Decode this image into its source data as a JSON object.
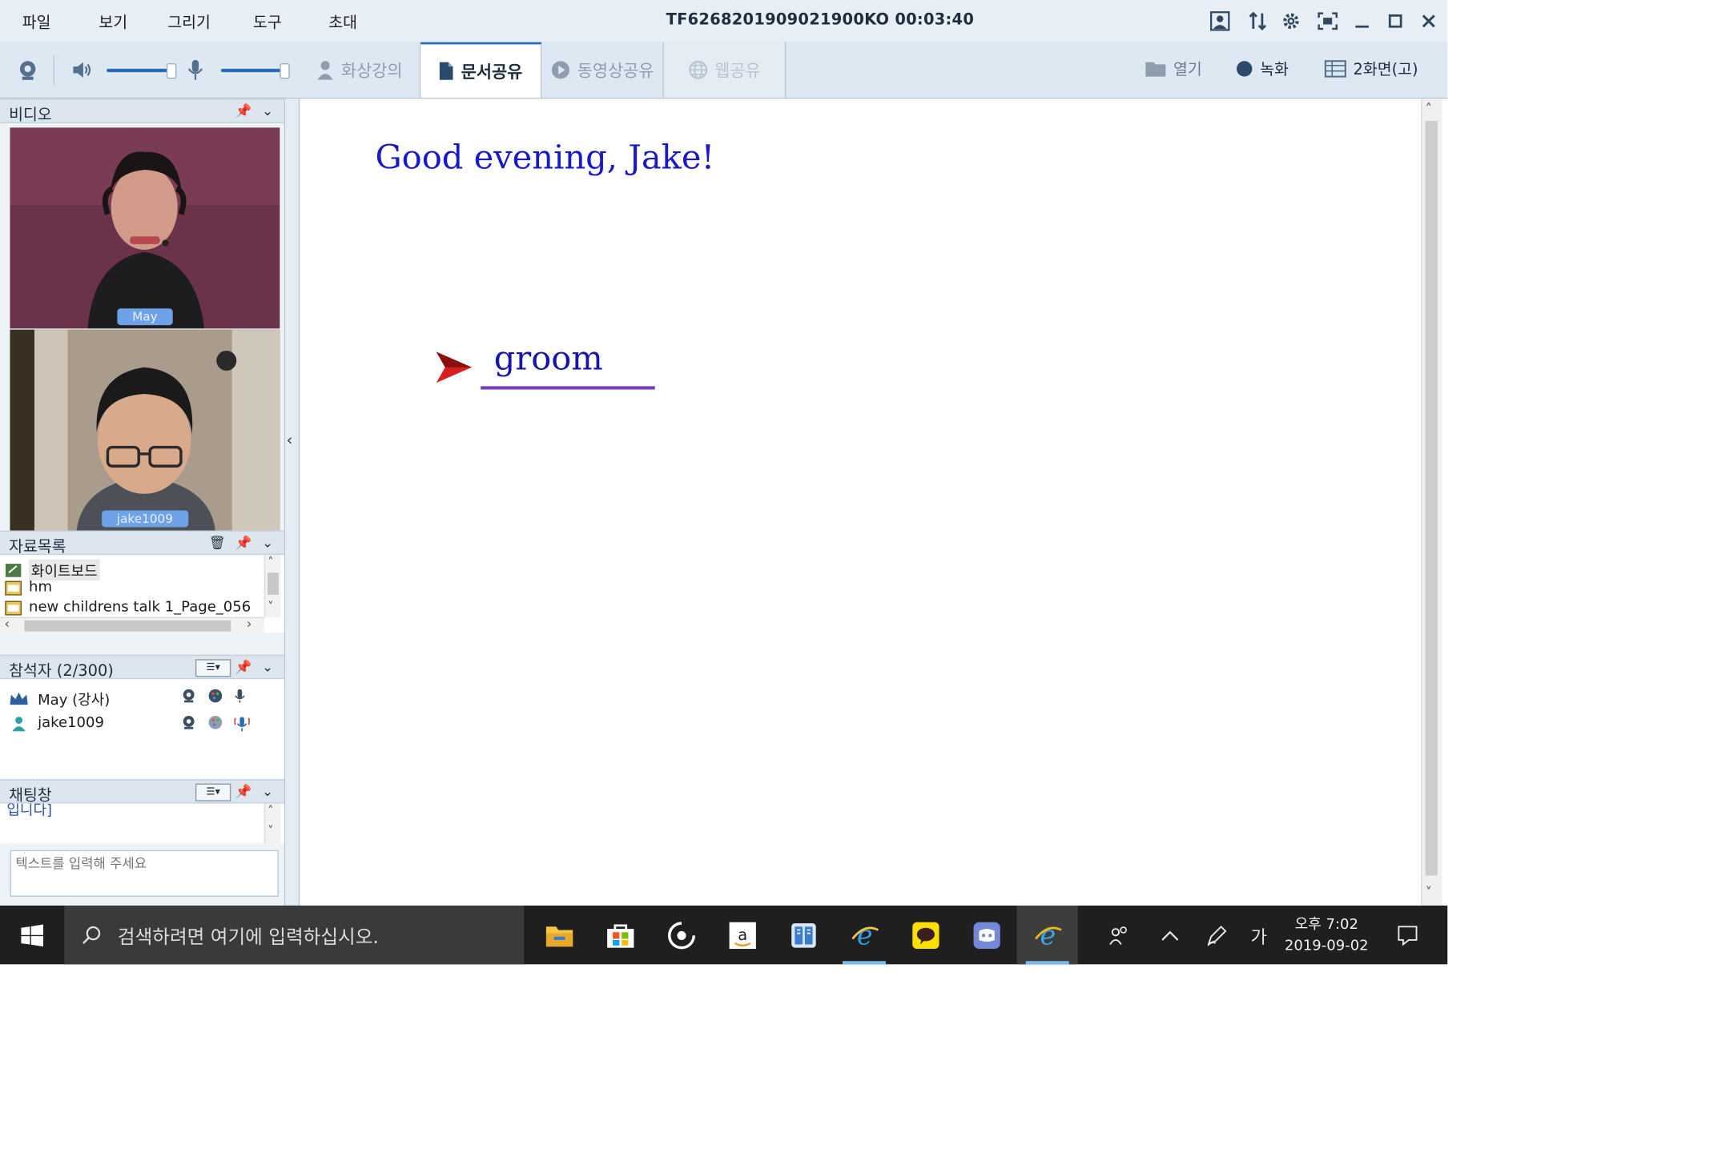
{
  "menu": {
    "items": [
      "파일",
      "보기",
      "그리기",
      "도구",
      "초대"
    ]
  },
  "window": {
    "title": "TF6268201909021900KO 00:03:40"
  },
  "toolbar": {
    "tabs": [
      {
        "label": "화상강의",
        "state": "normal"
      },
      {
        "label": "문서공유",
        "state": "active"
      },
      {
        "label": "동영상공유",
        "state": "normal"
      },
      {
        "label": "웹공유",
        "state": "disabled"
      }
    ],
    "open_label": "열기",
    "record_label": "녹화",
    "layout_label": "2화면(고)"
  },
  "sidebar": {
    "video": {
      "title": "비디오",
      "feeds": [
        {
          "name": "May"
        },
        {
          "name": "jake1009"
        }
      ]
    },
    "materials": {
      "title": "자료목록",
      "items": [
        "화이트보드",
        "hm",
        "new childrens talk 1_Page_056"
      ]
    },
    "participants": {
      "title": "참석자 (2/300)",
      "items": [
        {
          "name": "May (강사)"
        },
        {
          "name": "jake1009"
        }
      ]
    },
    "chat": {
      "title": "채팅창",
      "log_text": "입니다]",
      "input_placeholder": "텍스트를 입력해 주세요"
    }
  },
  "document": {
    "greeting": "Good evening, Jake!",
    "word": "groom"
  },
  "taskbar": {
    "search_placeholder": "검색하려면 여기에 입력하십시오.",
    "ime_label": "가",
    "clock_time": "오후 7:02",
    "clock_date": "2019-09-02"
  },
  "colors": {
    "accent": "#2a6cb5",
    "doc_text": "#1919cc",
    "arrow": "#d42020",
    "underline": "#7b3fb3",
    "taskbar": "#1f1f1f"
  }
}
